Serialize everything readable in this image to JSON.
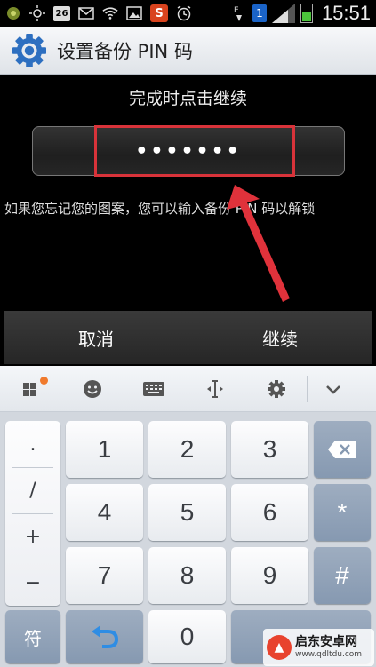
{
  "status_bar": {
    "date_badge": "26",
    "shop_badge": "S",
    "sim_slot": "1",
    "time": "15:51"
  },
  "header": {
    "title": "设置备份 PIN 码"
  },
  "main": {
    "prompt": "完成时点击继续",
    "pin_value": "•••••••",
    "hint": "如果您忘记您的图案，您可以输入备份 PIN 码以解锁"
  },
  "actions": {
    "cancel_label": "取消",
    "continue_label": "继续"
  },
  "keyboard": {
    "symbols": [
      ".",
      "/",
      "+",
      "−"
    ],
    "digits": [
      "1",
      "2",
      "3",
      "4",
      "5",
      "6",
      "7",
      "8",
      "9",
      "0"
    ],
    "star": "*",
    "hash": "#",
    "symbol_toggle": "符",
    "toolbar_icons": [
      "apps-icon",
      "emoji-icon",
      "keyboard-icon",
      "cursor-icon",
      "settings-icon",
      "chevron-down-icon"
    ]
  },
  "watermark": {
    "name": "启东安卓网",
    "url": "www.qdltdu.com"
  },
  "colors": {
    "accent_red": "#d8333a",
    "title_bar": "#e9ecf0",
    "key_dark": "#8699b1"
  }
}
